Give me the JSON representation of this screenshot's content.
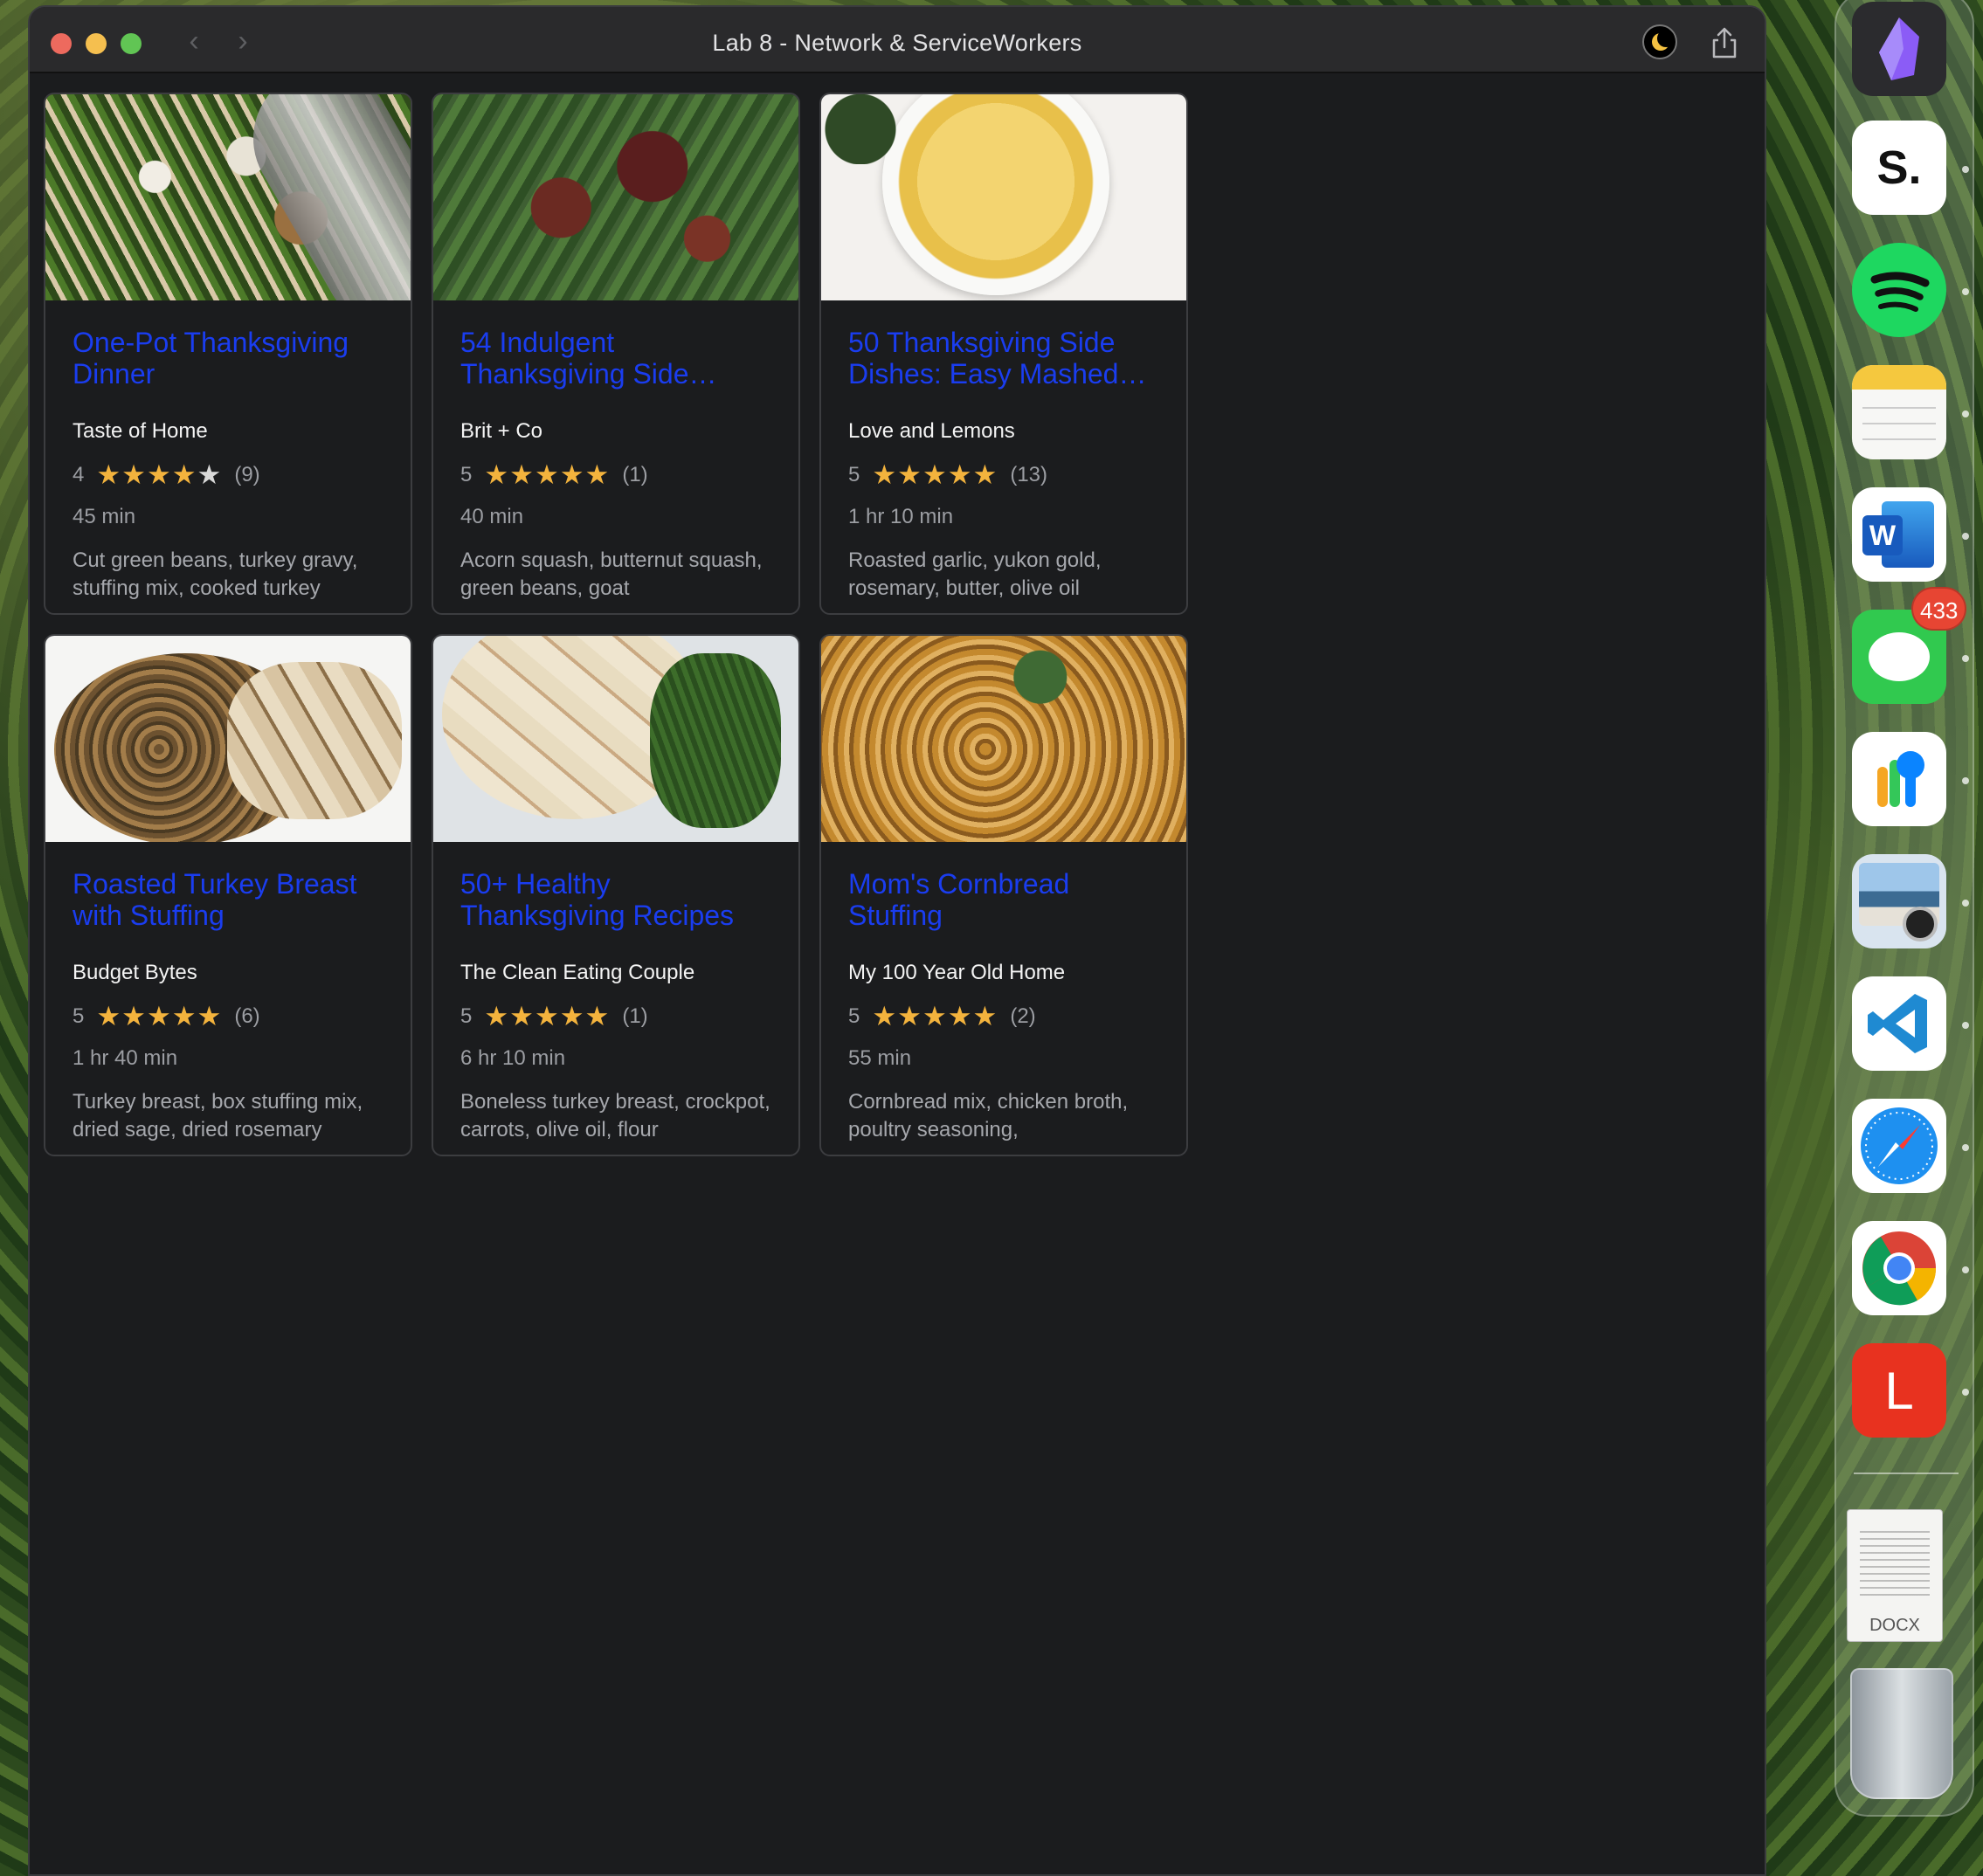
{
  "window": {
    "title": "Lab 8 - Network & ServiceWorkers",
    "back_glyph": "‹",
    "forward_glyph": "›"
  },
  "recipes": [
    {
      "title": "One-Pot Thanksgiving Dinner",
      "source": "Taste of Home",
      "rating": "4",
      "stars_filled": "★★★★",
      "stars_empty": "★",
      "count": "(9)",
      "time": "45 min",
      "ingredients": "Cut green beans, turkey gravy, stuffing mix, cooked turkey"
    },
    {
      "title": "54 Indulgent Thanksgiving Side…",
      "source": "Brit + Co",
      "rating": "5",
      "stars_filled": "★★★★★",
      "stars_empty": "",
      "count": "(1)",
      "time": "40 min",
      "ingredients": "Acorn squash, butternut squash, green beans, goat"
    },
    {
      "title": "50 Thanksgiving Side Dishes: Easy Mashed…",
      "source": "Love and Lemons",
      "rating": "5",
      "stars_filled": "★★★★★",
      "stars_empty": "",
      "count": "(13)",
      "time": "1 hr 10 min",
      "ingredients": "Roasted garlic, yukon gold, rosemary, butter, olive oil"
    },
    {
      "title": "Roasted Turkey Breast with Stuffing",
      "source": "Budget Bytes",
      "rating": "5",
      "stars_filled": "★★★★★",
      "stars_empty": "",
      "count": "(6)",
      "time": "1 hr 40 min",
      "ingredients": "Turkey breast, box stuffing mix, dried sage, dried rosemary"
    },
    {
      "title": "50+ Healthy Thanksgiving Recipes",
      "source": "The Clean Eating Couple",
      "rating": "5",
      "stars_filled": "★★★★★",
      "stars_empty": "",
      "count": "(1)",
      "time": "6 hr 10 min",
      "ingredients": "Boneless turkey breast, crockpot, carrots, olive oil, flour"
    },
    {
      "title": "Mom's Cornbread Stuffing",
      "source": "My 100 Year Old Home",
      "rating": "5",
      "stars_filled": "★★★★★",
      "stars_empty": "",
      "count": "(2)",
      "time": "55 min",
      "ingredients": "Cornbread mix, chicken broth, poultry seasoning,"
    }
  ],
  "dock": {
    "apps": [
      {
        "name": "obsidian-icon",
        "color": "#2b2b2e"
      },
      {
        "name": "s-app-icon",
        "label": "S.",
        "color": "#ffffff"
      },
      {
        "name": "spotify-icon",
        "color": "#1ed760"
      },
      {
        "name": "notes-icon",
        "color": "#f7f7f5"
      },
      {
        "name": "word-icon",
        "label": "W",
        "color": "#ffffff"
      },
      {
        "name": "messages-icon",
        "color": "#31c94f"
      },
      {
        "name": "passwords-icon",
        "color": "#ffffff"
      },
      {
        "name": "preview-icon",
        "color": "#d9e4ef"
      },
      {
        "name": "vscode-icon",
        "color": "#ffffff"
      },
      {
        "name": "safari-icon",
        "color": "#ffffff"
      },
      {
        "name": "chrome-icon",
        "color": "#ffffff"
      },
      {
        "name": "l-app-icon",
        "label": "L",
        "color": "#e8321f"
      }
    ],
    "messages_badge": "433",
    "docx_label": "DOCX"
  },
  "colors": {
    "link": "#1a3df0",
    "star": "#f3b33d",
    "background": "#1b1c1e"
  }
}
